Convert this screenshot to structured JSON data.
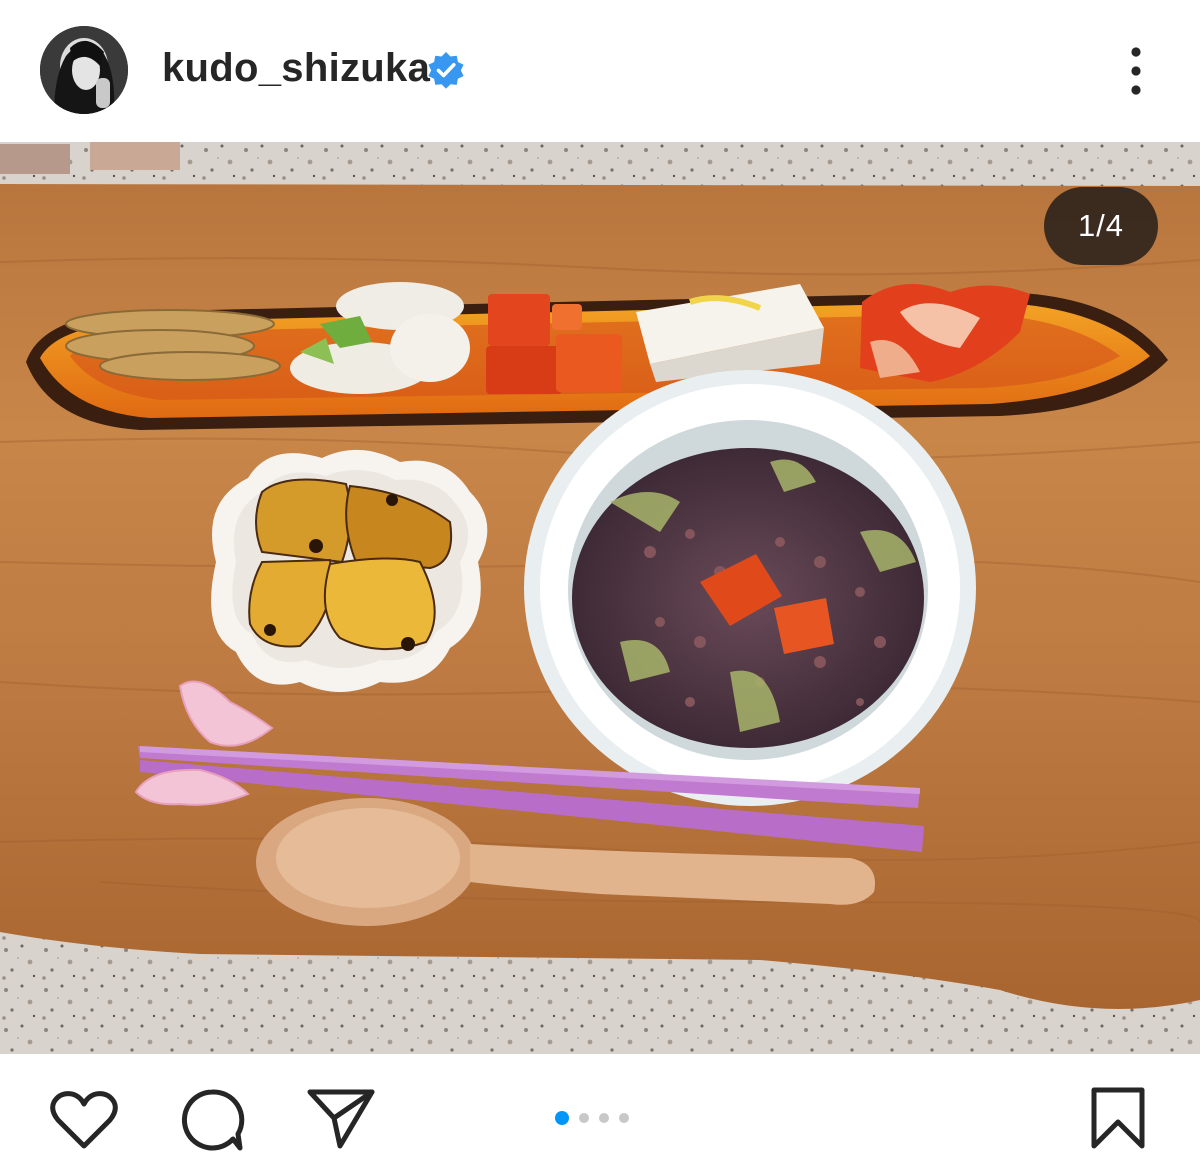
{
  "header": {
    "username": "kudo_shizuka",
    "verified_icon": "verified-badge-icon",
    "more_icon": "more-options-icon",
    "verified_color": "#3897f0"
  },
  "media": {
    "counter": "1/4",
    "current_slide": 1,
    "total_slides": 4,
    "description_icon": "food-photo"
  },
  "actions": {
    "like_icon": "heart-icon",
    "comment_icon": "comment-icon",
    "share_icon": "send-icon",
    "save_icon": "bookmark-icon",
    "active_dot_color": "#0095f6"
  }
}
